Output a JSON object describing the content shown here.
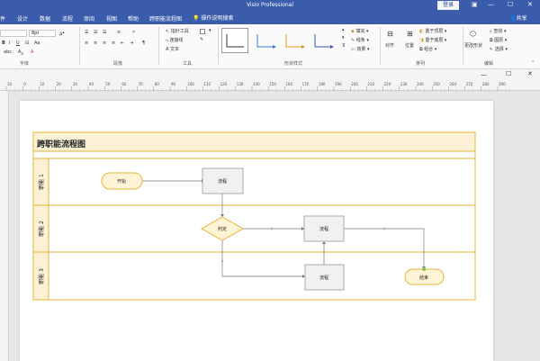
{
  "app": {
    "title": "Visio Professional",
    "login": "登录",
    "share": "共享",
    "tell_me": "操作说明搜索"
  },
  "menu": {
    "items": [
      "文件",
      "开始",
      "设计",
      "数据",
      "流程",
      "审阅",
      "视图",
      "帮助",
      "跨职能流程图"
    ]
  },
  "ribbon": {
    "font": {
      "name": "",
      "size": "8pt",
      "label": "字体"
    },
    "paragraph": {
      "label": "段落"
    },
    "tools": {
      "label": "工具",
      "pointer": "指针工具",
      "connector": "连接线",
      "text": "文本"
    },
    "shape_styles": {
      "label": "形状样式",
      "fill": "填充",
      "line": "线条",
      "effects": "效果"
    },
    "arrange": {
      "label": "排列",
      "align": "对齐",
      "position": "位置",
      "bring_front": "置于顶层",
      "send_back": "置于底层",
      "group": "组合"
    },
    "editing": {
      "label": "编辑",
      "change_shape": "更改形状",
      "find": "查找",
      "layers": "图层",
      "select": "选择"
    }
  },
  "ruler": {
    "ticks": [
      "10",
      "0",
      "10",
      "20",
      "30",
      "40",
      "50",
      "60",
      "70",
      "80",
      "90",
      "100",
      "110",
      "120",
      "130",
      "140",
      "150",
      "160",
      "170",
      "180",
      "190",
      "200",
      "210",
      "220",
      "230",
      "240",
      "250",
      "260",
      "270",
      "280",
      "290"
    ]
  },
  "diagram": {
    "title": "跨职能流程图",
    "lanes": [
      "职能 1",
      "职能 2",
      "职能 3"
    ],
    "shapes": {
      "start": "开始",
      "process1": "流程",
      "decision": "判定",
      "process2": "流程",
      "process3": "流程",
      "end": "结束"
    }
  },
  "colors": {
    "title_bar": "#3b5bab",
    "lane_border": "#e7b33a",
    "lane_fill": "#fdf2d6",
    "start_end": "#fff5d6",
    "process_fill": "#f1f1f1"
  }
}
